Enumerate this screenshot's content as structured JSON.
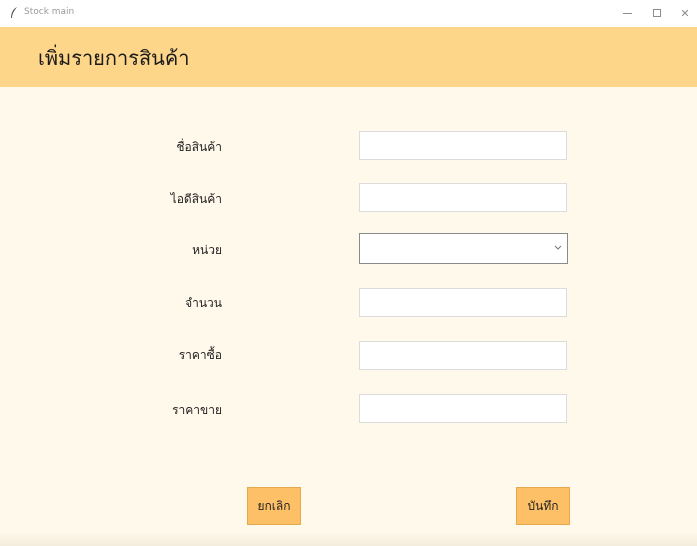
{
  "window": {
    "title": "Stock main",
    "icon": "feather-icon",
    "controls": {
      "minimize": "–",
      "maximize": "☐",
      "close": "✕"
    }
  },
  "header": {
    "title": "เพิ่มรายการสินค้า"
  },
  "form": {
    "fields": [
      {
        "label": "ชื่อสินค้า",
        "value": "",
        "type": "text"
      },
      {
        "label": "ไอดีสินค้า",
        "value": "",
        "type": "text"
      },
      {
        "label": "หน่วย",
        "value": "",
        "type": "select"
      },
      {
        "label": "จำนวน",
        "value": "",
        "type": "text"
      },
      {
        "label": "ราคาซื้อ",
        "value": "",
        "type": "text"
      },
      {
        "label": "ราคาขาย",
        "value": "",
        "type": "text"
      }
    ]
  },
  "buttons": {
    "cancel_label": "ยกเลิก",
    "save_label": "บันทึก"
  },
  "colors": {
    "header_bg": "#fdd68a",
    "window_bg": "#fff9ec",
    "button_bg": "#fdc067"
  }
}
